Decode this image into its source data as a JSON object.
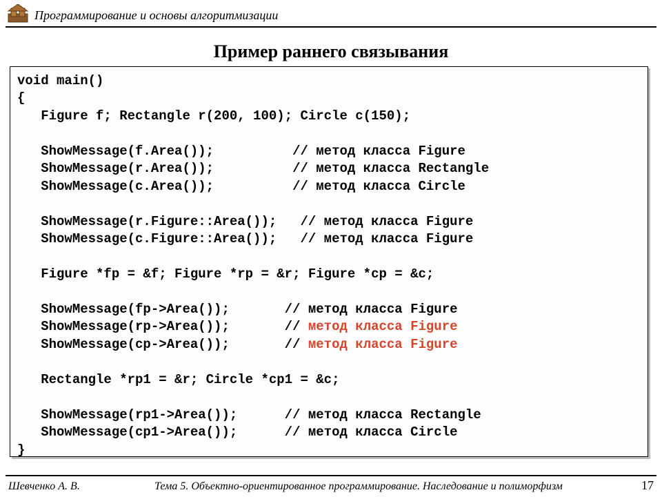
{
  "header": {
    "course_title": "Программирование и основы алгоритмизации"
  },
  "slide": {
    "title": "Пример раннего связывания"
  },
  "code": {
    "l01": "void main()",
    "l02": "{",
    "l03": "   Figure f; Rectangle r(200, 100); Circle c(150);",
    "l04": "",
    "l05": "   ShowMessage(f.Area());          // метод класса Figure",
    "l06": "   ShowMessage(r.Area());          // метод класса Rectangle",
    "l07": "   ShowMessage(c.Area());          // метод класса Circle",
    "l08": "",
    "l09": "   ShowMessage(r.Figure::Area());   // метод класса Figure",
    "l10": "   ShowMessage(c.Figure::Area());   // метод класса Figure",
    "l11": "",
    "l12": "   Figure *fp = &f; Figure *rp = &r; Figure *cp = &c;",
    "l13": "",
    "l14": "   ShowMessage(fp->Area());       // метод класса Figure",
    "l15a": "   ShowMessage(rp->Area());       // ",
    "l15b": "метод класса Figure",
    "l16a": "   ShowMessage(cp->Area());       // ",
    "l16b": "метод класса Figure",
    "l17": "",
    "l18": "   Rectangle *rp1 = &r; Circle *cp1 = &c;",
    "l19": "",
    "l20": "   ShowMessage(rp1->Area());      // метод класса Rectangle",
    "l21": "   ShowMessage(cp1->Area());      // метод класса Circle",
    "l22": "}"
  },
  "footer": {
    "author": "Шевченко А. В.",
    "topic": "Тема 5. Объектно-ориентированное программирование. Наследование и полиморфизм",
    "page": "17"
  }
}
